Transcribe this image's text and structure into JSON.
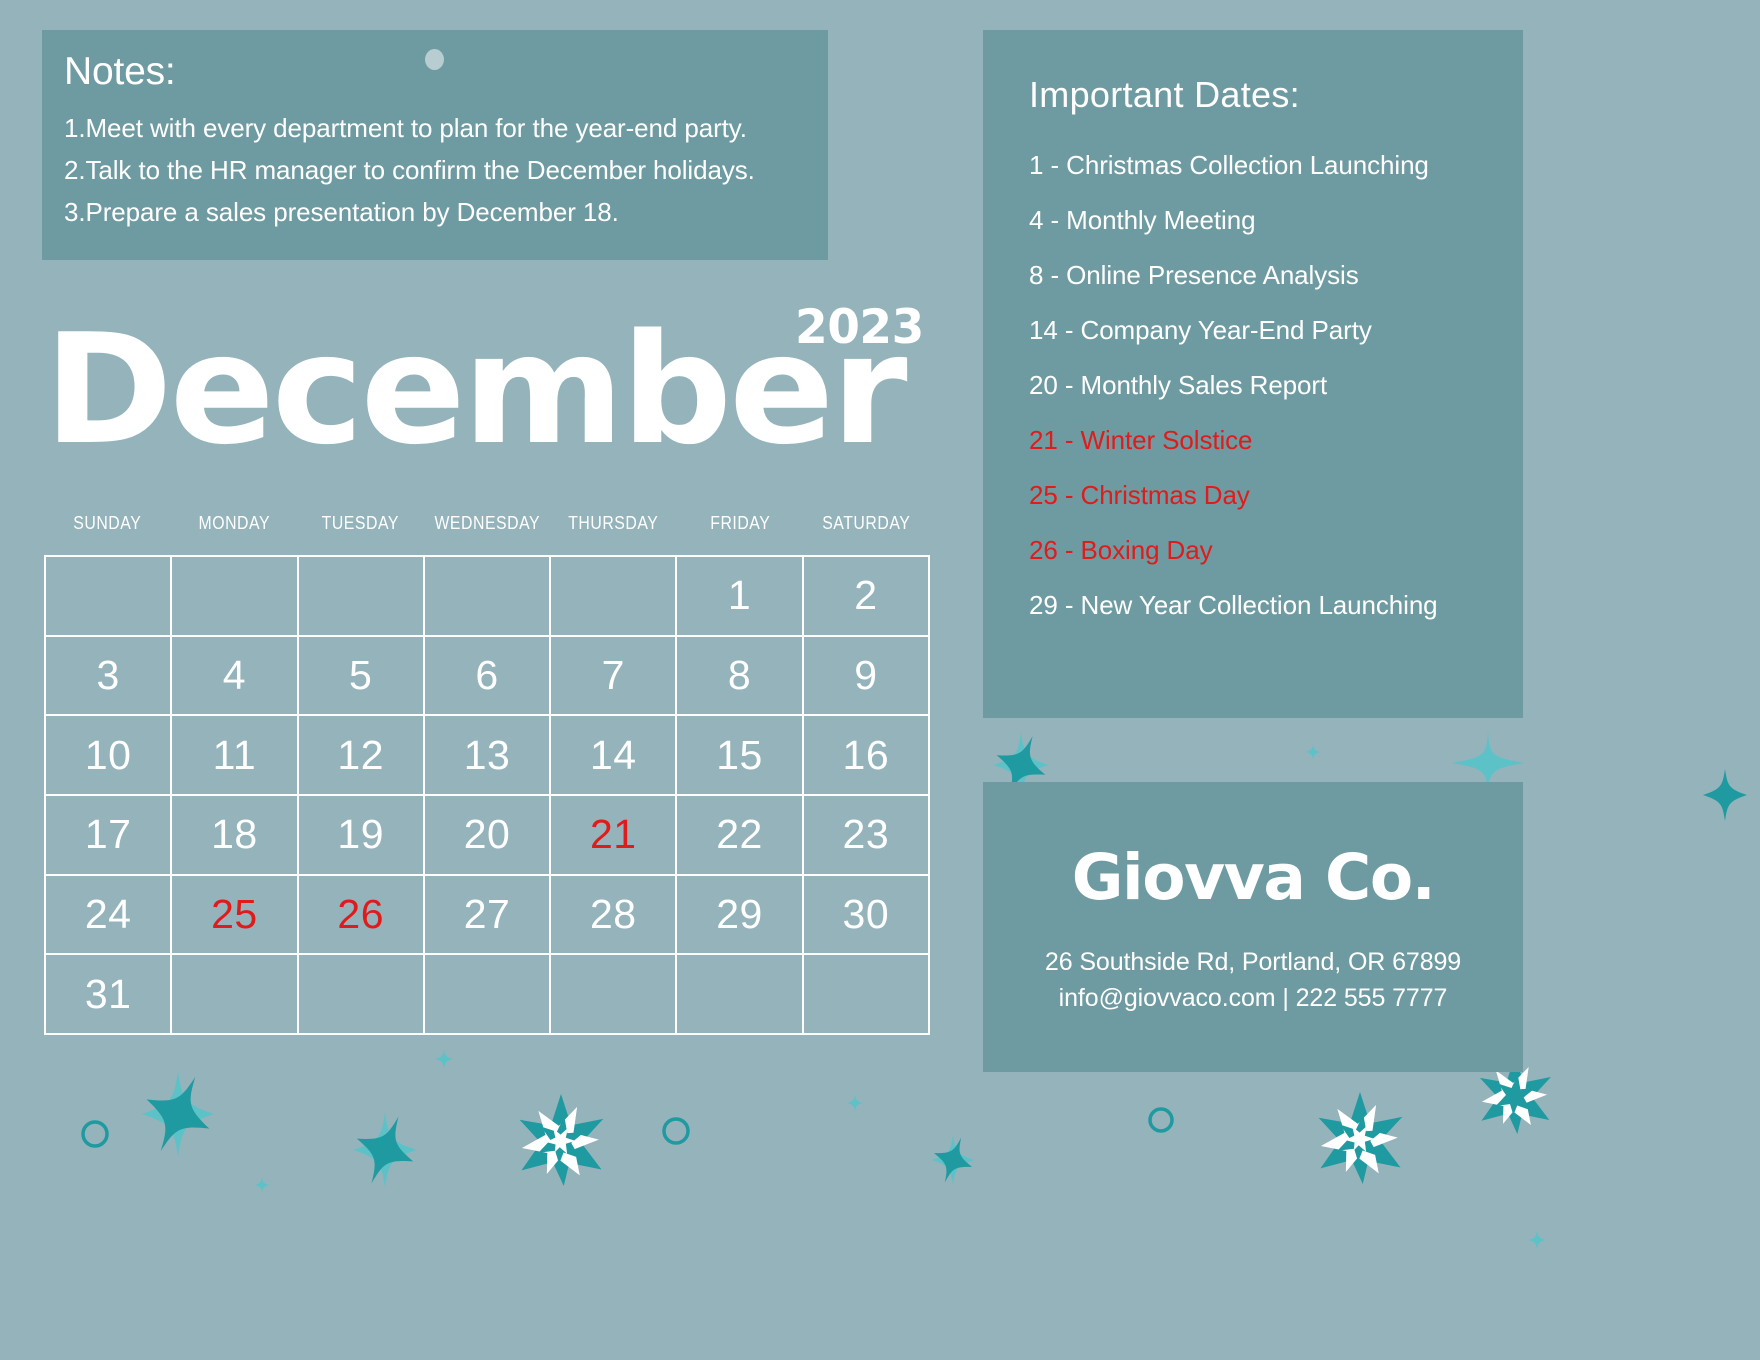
{
  "notes": {
    "title": "Notes:",
    "items": [
      "1.Meet with every department to plan for the year-end party.",
      "2.Talk to the HR manager to confirm the December holidays.",
      "3.Prepare a sales presentation by December 18."
    ]
  },
  "calendar": {
    "month": "December",
    "year": "2023",
    "weekdays": [
      "SUNDAY",
      "MONDAY",
      "TUESDAY",
      "WEDNESDAY",
      "THURSDAY",
      "FRIDAY",
      "SATURDAY"
    ],
    "weeks": [
      [
        "",
        "",
        "",
        "",
        "",
        "1",
        "2"
      ],
      [
        "3",
        "4",
        "5",
        "6",
        "7",
        "8",
        "9"
      ],
      [
        "10",
        "11",
        "12",
        "13",
        "14",
        "15",
        "16"
      ],
      [
        "17",
        "18",
        "19",
        "20",
        "21",
        "22",
        "23"
      ],
      [
        "24",
        "25",
        "26",
        "27",
        "28",
        "29",
        "30"
      ],
      [
        "31",
        "",
        "",
        "",
        "",
        "",
        ""
      ]
    ],
    "holiday_days": [
      "21",
      "25",
      "26"
    ]
  },
  "important_dates": {
    "title": "Important Dates:",
    "items": [
      {
        "text": "1 - Christmas Collection Launching",
        "highlight": false
      },
      {
        "text": "4 -  Monthly Meeting",
        "highlight": false
      },
      {
        "text": " 8 - Online Presence Analysis",
        "highlight": false
      },
      {
        "text": "14 - Company Year-End Party",
        "highlight": false
      },
      {
        "text": "20 -  Monthly Sales Report",
        "highlight": false
      },
      {
        "text": "21 - Winter Solstice",
        "highlight": true
      },
      {
        "text": "25 - Christmas Day",
        "highlight": true
      },
      {
        "text": "26 - Boxing Day",
        "highlight": true
      },
      {
        "text": "29 - New Year Collection Launching",
        "highlight": false
      }
    ]
  },
  "brand": {
    "name": "Giovva Co.",
    "address": "26 Southside Rd, Portland, OR 67899",
    "contact": "info@giovvaco.com | 222 555 7777"
  },
  "colors": {
    "background": "#94b3bb",
    "panel": "#6e9ba1",
    "text": "#ffffff",
    "holiday_red": "#e01b1b",
    "star_teal": "#1f9aa0",
    "star_light_teal": "#5cc2c8"
  }
}
